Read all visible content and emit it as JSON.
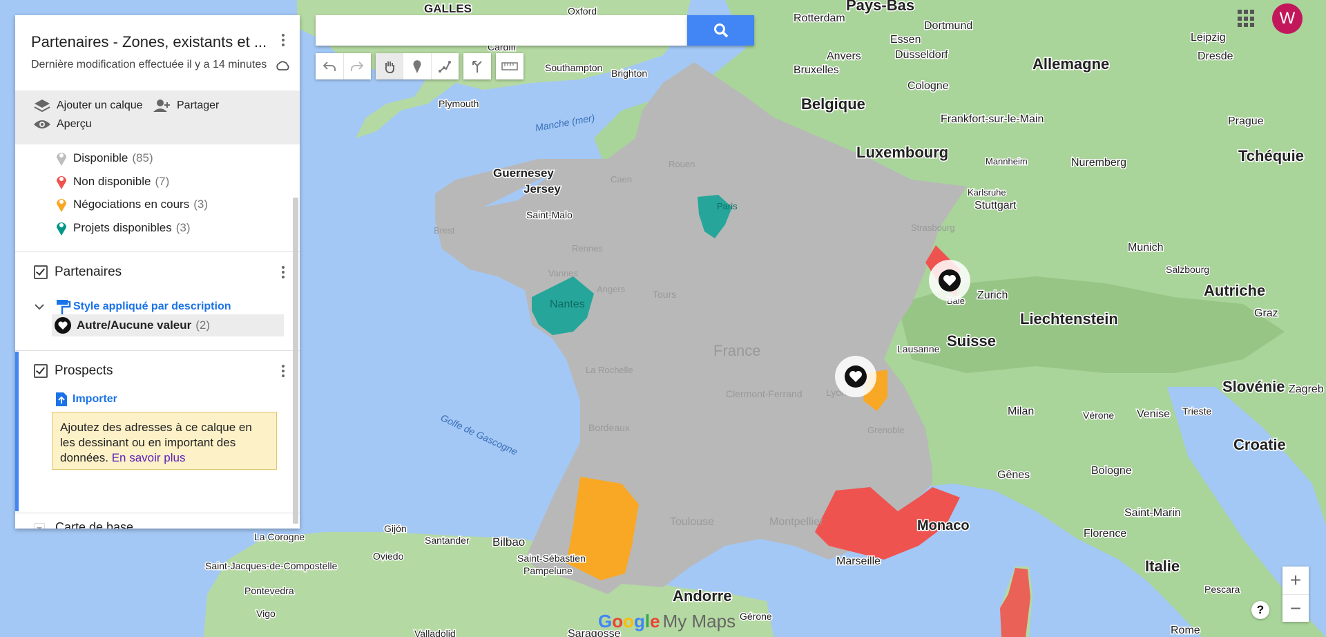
{
  "panel": {
    "title": "Partenaires - Zones, existants et ...",
    "subtitle": "Dernière modification effectuée il y a 14 minutes",
    "tools": {
      "add_layer": "Ajouter un calque",
      "share": "Partager",
      "preview": "Aperçu"
    },
    "legend": [
      {
        "label": "Disponible",
        "count": "(85)",
        "color": "#bdbdbd"
      },
      {
        "label": "Non disponible",
        "count": "(7)",
        "color": "#ef5350"
      },
      {
        "label": "Négociations en cours",
        "count": "(3)",
        "color": "#f9a825"
      },
      {
        "label": "Projets disponibles",
        "count": "(3)",
        "color": "#009688"
      }
    ],
    "partners_layer": {
      "title": "Partenaires",
      "style_link": "Style appliqué par description",
      "value_label": "Autre/Aucune valeur",
      "value_count": "(2)"
    },
    "prospects_layer": {
      "title": "Prospects",
      "import_link": "Importer",
      "tip_text": "Ajoutez des adresses à ce calque en les dessinant ou en important des données.",
      "tip_link": "En savoir plus"
    },
    "base_map": "Carte de base"
  },
  "search": {
    "placeholder": ""
  },
  "toolbar": [
    "undo-icon",
    "redo-icon",
    "hand-icon",
    "marker-icon",
    "draw-line-icon",
    "directions-icon",
    "ruler-icon"
  ],
  "account": {
    "initial": "W",
    "color": "#c2185b"
  },
  "zoom": {
    "in": "+",
    "out": "−"
  },
  "help": "?",
  "brand": {
    "google": "Google",
    "mymaps": "My Maps"
  },
  "map": {
    "countries": [
      "Pays-Bas",
      "Belgique",
      "Luxembourg",
      "Allemagne",
      "Tchéquie",
      "Autriche",
      "Suisse",
      "Liechtenstein",
      "Slovénie",
      "Croatie",
      "Italie",
      "France",
      "Andorre",
      "Monaco",
      "GALLES"
    ],
    "cities": [
      "Rotterdam",
      "Dortmund",
      "Leipzig",
      "Essen",
      "Anvers",
      "Düsseldorf",
      "Dresde",
      "Bruxelles",
      "Cologne",
      "Frankfort-sur-le-Main",
      "Prague",
      "Mannheim",
      "Nuremberg",
      "Stuttgart",
      "Karlsruhe",
      "Munich",
      "Salzbourg",
      "Zurich",
      "Bâle",
      "Lausanne",
      "Graz",
      "Zagreb",
      "Milan",
      "Vérone",
      "Venise",
      "Trieste",
      "Gênes",
      "Bologne",
      "Saint-Marin",
      "Florence",
      "Pescara",
      "Rome",
      "Marseille",
      "Montpellier",
      "Toulouse",
      "Bordeaux",
      "Nantes",
      "Rennes",
      "Brest",
      "Saint-Malo",
      "Caen",
      "Rouen",
      "Paris",
      "Tours",
      "Angers",
      "Vannes",
      "La Rochelle",
      "Clermont-Ferrand",
      "Lyon",
      "Grenoble",
      "Strasbourg",
      "Guernesey",
      "Jersey",
      "Oxford",
      "Cardiff",
      "Southampton",
      "Brighton",
      "Plymouth",
      "Bilbao",
      "Saint-Sébastien",
      "Pampelune",
      "Santander",
      "Oviedo",
      "Gijón",
      "La Corogne",
      "Saint-Jacques-de-Compostelle",
      "Pontevedra",
      "Vigo",
      "Valladolid",
      "Saragosse",
      "Gérone"
    ],
    "seas": [
      "Manche (mer)",
      "Golfe de Gascogne"
    ]
  }
}
